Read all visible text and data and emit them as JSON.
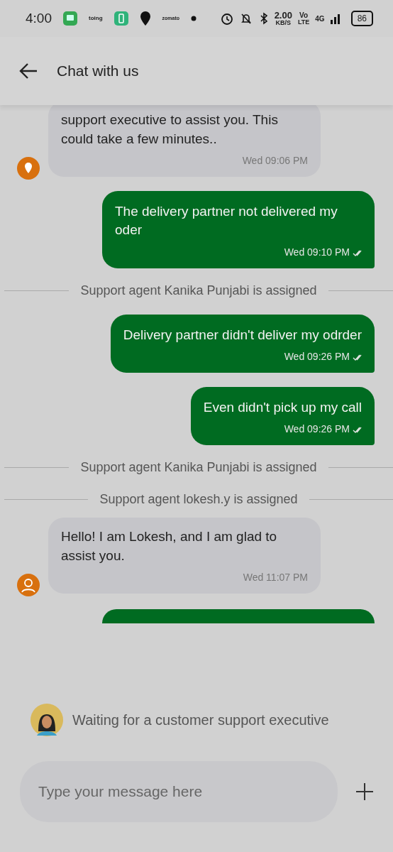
{
  "status_bar": {
    "time": "4:00",
    "app_labels": [
      "toing",
      "zomato"
    ],
    "speed": "2.00",
    "speed_unit": "KB/S",
    "volte_top": "Vo",
    "volte_bottom": "LTE",
    "network": "4G",
    "battery": "86"
  },
  "header": {
    "title": "Chat with us"
  },
  "messages": [
    {
      "kind": "incoming_bot",
      "text": "support executive to assist you. This could take a few minutes..",
      "time": "Wed 09:06 PM"
    },
    {
      "kind": "outgoing",
      "text": "The delivery partner not delivered my oder",
      "time": "Wed 09:10 PM",
      "read": true
    },
    {
      "kind": "system",
      "text": "Support agent Kanika Punjabi is assigned"
    },
    {
      "kind": "outgoing",
      "text": "Delivery partner didn't deliver my odrder",
      "time": "Wed 09:26 PM",
      "read": true
    },
    {
      "kind": "outgoing",
      "text": "Even didn't pick up my call",
      "time": "Wed 09:26 PM",
      "read": true
    },
    {
      "kind": "system",
      "text": "Support agent Kanika Punjabi is assigned"
    },
    {
      "kind": "system",
      "text": "Support agent lokesh.y is assigned"
    },
    {
      "kind": "incoming_agent",
      "text": "Hello! I am Lokesh, and I am glad to assist you.",
      "time": "Wed 11:07 PM"
    },
    {
      "kind": "outgoing_cut"
    }
  ],
  "waiting": {
    "text": "Waiting for a customer support executive"
  },
  "composer": {
    "placeholder": "Type your message here"
  }
}
